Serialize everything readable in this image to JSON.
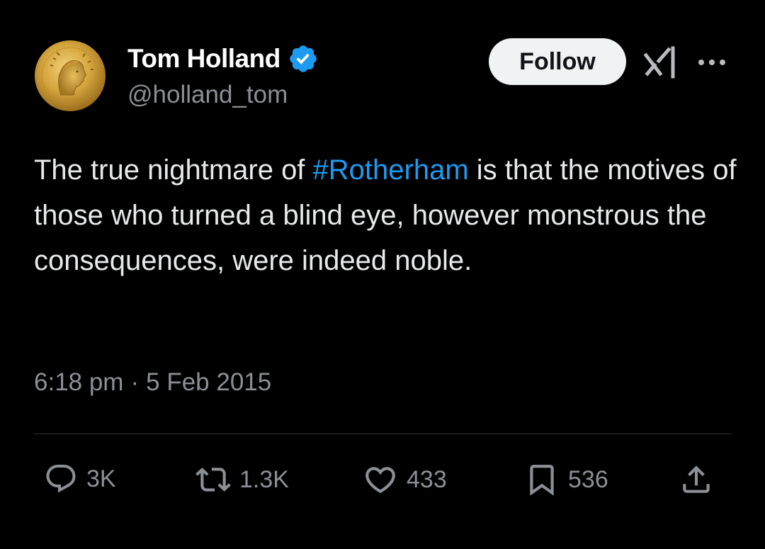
{
  "author": {
    "display_name": "Tom Holland",
    "handle": "@holland_tom",
    "avatar_icon": "roman-coin-avatar",
    "verified_icon": "verified-badge-icon",
    "verified_color": "#1d9bf0"
  },
  "header": {
    "follow_label": "Follow",
    "grok_icon": "grok-icon",
    "more_icon": "more-options-icon"
  },
  "tweet": {
    "text_before": "The true nightmare of ",
    "hashtag": "#Rotherham",
    "text_after": " is that the motives of those who turned a blind eye, however monstrous the consequences, were indeed noble.",
    "time": "6:18 pm",
    "separator": "·",
    "date": "5 Feb 2015"
  },
  "actions": {
    "replies": "3K",
    "reposts": "1.3K",
    "likes": "433",
    "bookmarks": "536"
  },
  "colors": {
    "background": "#000000",
    "text": "#e7e9ea",
    "secondary": "#8b9096",
    "link": "#1d9bf0",
    "follow_bg": "#eff3f4"
  }
}
